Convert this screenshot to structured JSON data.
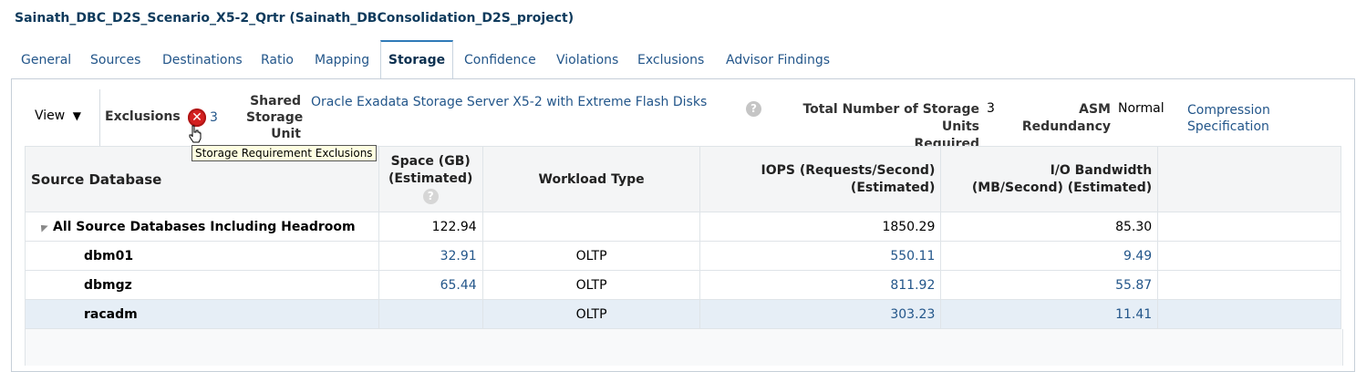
{
  "page_title": "Sainath_DBC_D2S_Scenario_X5-2_Qrtr (Sainath_DBConsolidation_D2S_project)",
  "tabs": [
    "General",
    "Sources",
    "Destinations",
    "Ratio",
    "Mapping",
    "Storage",
    "Confidence",
    "Violations",
    "Exclusions",
    "Advisor Findings"
  ],
  "active_tab": "Storage",
  "toolbar": {
    "view_label": "View",
    "view_arrow": "▼",
    "exclusions_label": "Exclusions",
    "exclusions_count": "3",
    "exclusions_icon": "error-x-icon",
    "tooltip": "Storage Requirement Exclusions",
    "shared_label_1": "Shared",
    "shared_label_2": "Storage",
    "shared_label_3": "Unit",
    "shared_value": "Oracle Exadata Storage Server X5-2 with Extreme Flash Disks",
    "total_label_1": "Total Number of Storage Units",
    "total_label_2": "Required",
    "total_value": "3",
    "asm_label_1": "ASM",
    "asm_label_2": "Redundancy",
    "asm_value": "Normal",
    "compression_1": "Compression",
    "compression_2": "Specification"
  },
  "table": {
    "headers": {
      "source": "Source Database",
      "space_1": "Space (GB)",
      "space_2": "(Estimated)",
      "workload": "Workload Type",
      "iops_1": "IOPS (Requests/Second)",
      "iops_2": "(Estimated)",
      "io_1": "I/O Bandwidth",
      "io_2": "(MB/Second) (Estimated)"
    },
    "rows": [
      {
        "name": "All Source Databases Including Headroom",
        "space": "122.94",
        "workload": "",
        "iops": "1850.29",
        "io": "85.30"
      },
      {
        "name": "dbm01",
        "space": "32.91",
        "workload": "OLTP",
        "iops": "550.11",
        "io": "9.49"
      },
      {
        "name": "dbmgz",
        "space": "65.44",
        "workload": "OLTP",
        "iops": "811.92",
        "io": "55.87"
      },
      {
        "name": "racadm",
        "space": "",
        "workload": "OLTP",
        "iops": "303.23",
        "io": "11.41"
      }
    ]
  },
  "colors": {
    "link": "#23568a",
    "active_tab_border": "#2f7ab8",
    "selected_row": "#e6eef6",
    "error": "#d42020"
  }
}
